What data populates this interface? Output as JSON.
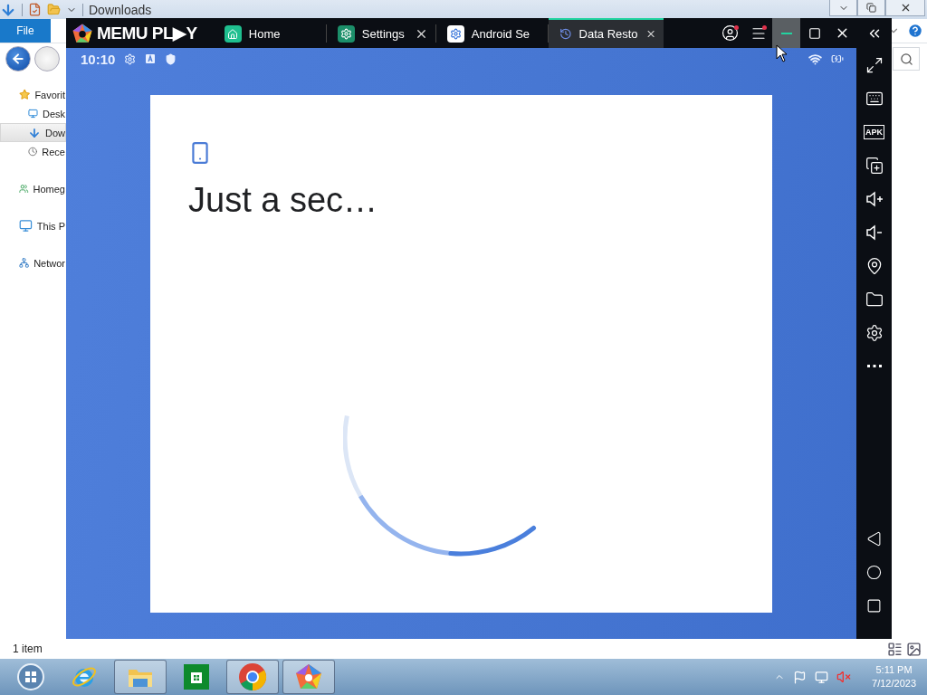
{
  "explorer": {
    "title": "Downloads",
    "ribbon_tab": "File",
    "status": "1 item",
    "nav": [
      {
        "label": "Favorit",
        "kind": "star",
        "selected": false,
        "children": [
          {
            "label": "Desk",
            "kind": "desktop",
            "selected": false
          },
          {
            "label": "Dow",
            "kind": "download",
            "selected": true
          },
          {
            "label": "Rece",
            "kind": "recent",
            "selected": false
          }
        ]
      },
      {
        "label": "Homeg",
        "kind": "homegroup",
        "selected": false
      },
      {
        "label": "This P",
        "kind": "pc",
        "selected": false
      },
      {
        "label": "Networ",
        "kind": "network",
        "selected": false
      }
    ]
  },
  "emulator": {
    "logo": "MEMU PL▶Y",
    "tabs": [
      {
        "label": "Home",
        "kind": "home",
        "closable": false,
        "selected": false
      },
      {
        "label": "Settings",
        "kind": "settings",
        "closable": true,
        "selected": false
      },
      {
        "label": "Android Se",
        "kind": "android-settings",
        "closable": false,
        "selected": false
      },
      {
        "label": "Data Resto",
        "kind": "restore",
        "closable": true,
        "selected": true
      }
    ],
    "clock": "10:10",
    "sidebar": [
      {
        "kind": "fullscreen"
      },
      {
        "kind": "keyboard"
      },
      {
        "kind": "apk",
        "label": "APK"
      },
      {
        "kind": "multi"
      },
      {
        "kind": "volume-up"
      },
      {
        "kind": "volume-down"
      },
      {
        "kind": "location"
      },
      {
        "kind": "folder"
      },
      {
        "kind": "settings"
      },
      {
        "kind": "more"
      }
    ],
    "nav_buttons": [
      {
        "kind": "back"
      },
      {
        "kind": "home"
      },
      {
        "kind": "recents"
      }
    ],
    "card": {
      "title": "Just a sec…"
    }
  },
  "taskbar": {
    "apps": [
      {
        "kind": "ie",
        "open": false
      },
      {
        "kind": "explorer",
        "open": true
      },
      {
        "kind": "store",
        "open": false
      },
      {
        "kind": "chrome",
        "open": true
      },
      {
        "kind": "memu",
        "open": true
      }
    ],
    "time": "5:11 PM",
    "date": "7/12/2023"
  }
}
